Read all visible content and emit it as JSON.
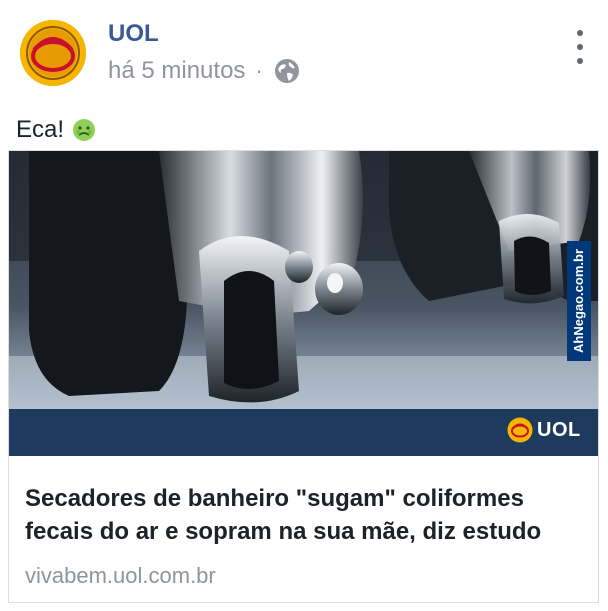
{
  "post": {
    "page_name": "UOL",
    "timestamp": "há 5 minutos",
    "separator": "·",
    "audience_icon": "globe-icon",
    "more_icon": "more-vertical-icon",
    "caption": "Eca!",
    "caption_emoji": "nauseated-face-emoji"
  },
  "link_card": {
    "image_watermark": "AhNegao.com.br",
    "image_logo_text": "UOL",
    "headline": "Secadores de banheiro \"sugam\" coliformes fecais do ar e sopram na sua mãe, diz estudo",
    "domain": "vivabem.uol.com.br"
  },
  "colors": {
    "page_name": "#3b5998",
    "meta": "#90949c",
    "brand_yellow": "#f7b500",
    "brand_red": "#c8102e",
    "image_band": "#1e3a5c"
  }
}
